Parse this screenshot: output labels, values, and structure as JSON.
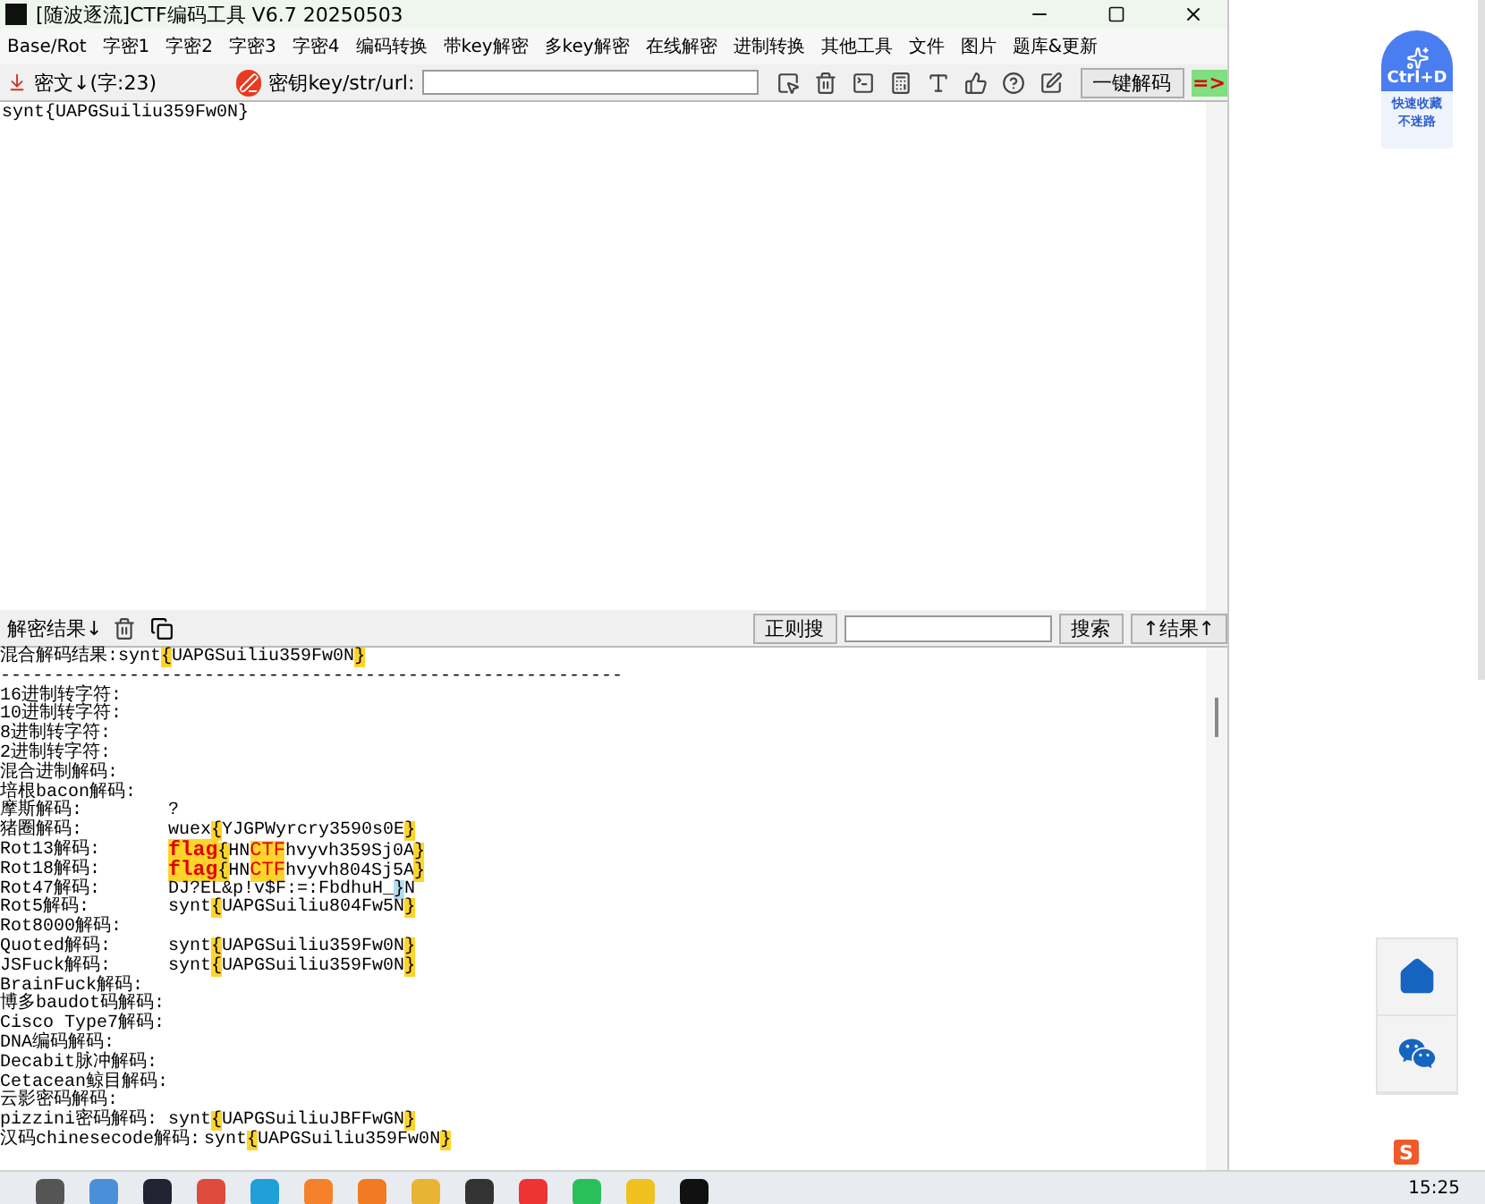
{
  "window": {
    "title": "[随波逐流]CTF编码工具 V6.7  20250503"
  },
  "menu": [
    "Base/Rot",
    "字密1",
    "字密2",
    "字密3",
    "字密4",
    "编码转换",
    "带key解密",
    "多key解密",
    "在线解密",
    "进制转换",
    "其他工具",
    "文件",
    "图片",
    "题库&更新"
  ],
  "cipher_bar": {
    "label": "密文↓(字:23)",
    "key_label": "密钥key/str/url:",
    "decode_button": "一键解码",
    "arrow": "=>"
  },
  "input_text": "synt{UAPGSuiliu359Fw0N}",
  "results_bar": {
    "label": "解密结果↓",
    "regex_button": "正则搜",
    "search_button": "搜索",
    "results_button": "↑结果↑"
  },
  "results": {
    "header": [
      {
        "text": "混合解码结果:synt",
        "kind": "none"
      },
      {
        "text": "{",
        "kind": "yellow"
      },
      {
        "text": "UAPGSuiliu359Fw0N",
        "kind": "none"
      },
      {
        "text": "}",
        "kind": "yellow"
      }
    ],
    "divider": "----------------------------------------------------------",
    "lines": [
      {
        "label": "16进制转字符:"
      },
      {
        "label": "10进制转字符:"
      },
      {
        "label": "8进制转字符:"
      },
      {
        "label": "2进制转字符:"
      },
      {
        "label": "混合进制解码:"
      },
      {
        "label": "培根bacon解码:"
      },
      {
        "label": "摩斯解码:",
        "value": [
          {
            "text": "?",
            "kind": "none"
          }
        ]
      },
      {
        "label": "猪圈解码:",
        "value": [
          {
            "text": "wuex",
            "kind": "none"
          },
          {
            "text": "{",
            "kind": "yellow"
          },
          {
            "text": "YJGPWyrcry3590s0E",
            "kind": "none"
          },
          {
            "text": "}",
            "kind": "yellow"
          }
        ]
      },
      {
        "label": "Rot13解码:",
        "value": [
          {
            "text": "flag",
            "kind": "flag"
          },
          {
            "text": "{",
            "kind": "yellow"
          },
          {
            "text": "HN",
            "kind": "none"
          },
          {
            "text": "CTF",
            "kind": "red"
          },
          {
            "text": "hvyvh359Sj0A",
            "kind": "none"
          },
          {
            "text": "}",
            "kind": "yellow"
          }
        ]
      },
      {
        "label": "Rot18解码:",
        "value": [
          {
            "text": "flag",
            "kind": "flag"
          },
          {
            "text": "{",
            "kind": "yellow"
          },
          {
            "text": "HN",
            "kind": "none"
          },
          {
            "text": "CTF",
            "kind": "red"
          },
          {
            "text": "hvyvh804Sj5A",
            "kind": "none"
          },
          {
            "text": "}",
            "kind": "yellow"
          }
        ]
      },
      {
        "label": "Rot47解码:",
        "value": [
          {
            "text": "DJ?EL&p!v$F:=:FbdhuH_",
            "kind": "none"
          },
          {
            "text": "}",
            "kind": "blue"
          },
          {
            "text": "N",
            "kind": "none"
          }
        ]
      },
      {
        "label": "Rot5解码:",
        "value": [
          {
            "text": "synt",
            "kind": "none"
          },
          {
            "text": "{",
            "kind": "yellow"
          },
          {
            "text": "UAPGSuiliu804Fw5N",
            "kind": "none"
          },
          {
            "text": "}",
            "kind": "yellow"
          }
        ]
      },
      {
        "label": "Rot8000解码:"
      },
      {
        "label": "Quoted解码:",
        "value": [
          {
            "text": "synt",
            "kind": "none"
          },
          {
            "text": "{",
            "kind": "yellow"
          },
          {
            "text": "UAPGSuiliu359Fw0N",
            "kind": "none"
          },
          {
            "text": "}",
            "kind": "yellow"
          }
        ]
      },
      {
        "label": "JSFuck解码:",
        "value": [
          {
            "text": "synt",
            "kind": "none"
          },
          {
            "text": "{",
            "kind": "yellow"
          },
          {
            "text": "UAPGSuiliu359Fw0N",
            "kind": "none"
          },
          {
            "text": "}",
            "kind": "yellow"
          }
        ]
      },
      {
        "label": "BrainFuck解码:"
      },
      {
        "label": "博多baudot码解码:"
      },
      {
        "label": "Cisco Type7解码:"
      },
      {
        "label": "DNA编码解码:"
      },
      {
        "label": "Decabit脉冲解码:"
      },
      {
        "label": "Cetacean鲸目解码:"
      },
      {
        "label": "云影密码解码:"
      },
      {
        "label": "pizzini密码解码:",
        "value": [
          {
            "text": "synt",
            "kind": "none"
          },
          {
            "text": "{",
            "kind": "yellow"
          },
          {
            "text": "UAPGSuiliuJBFFwGN",
            "kind": "none"
          },
          {
            "text": "}",
            "kind": "yellow"
          }
        ]
      },
      {
        "label": "汉码chinesecode解码:",
        "value": [
          {
            "text": "synt",
            "kind": "none"
          },
          {
            "text": "{",
            "kind": "yellow"
          },
          {
            "text": "UAPGSuiliu359Fw0N",
            "kind": "none"
          },
          {
            "text": "}",
            "kind": "yellow"
          }
        ]
      }
    ]
  },
  "browser_sidebar": {
    "bookmark_key": "Ctrl+D",
    "bookmark_caption": [
      "快速收藏",
      "不迷路"
    ]
  },
  "ime_icon": "S",
  "taskbar": {
    "time": "15:25"
  }
}
